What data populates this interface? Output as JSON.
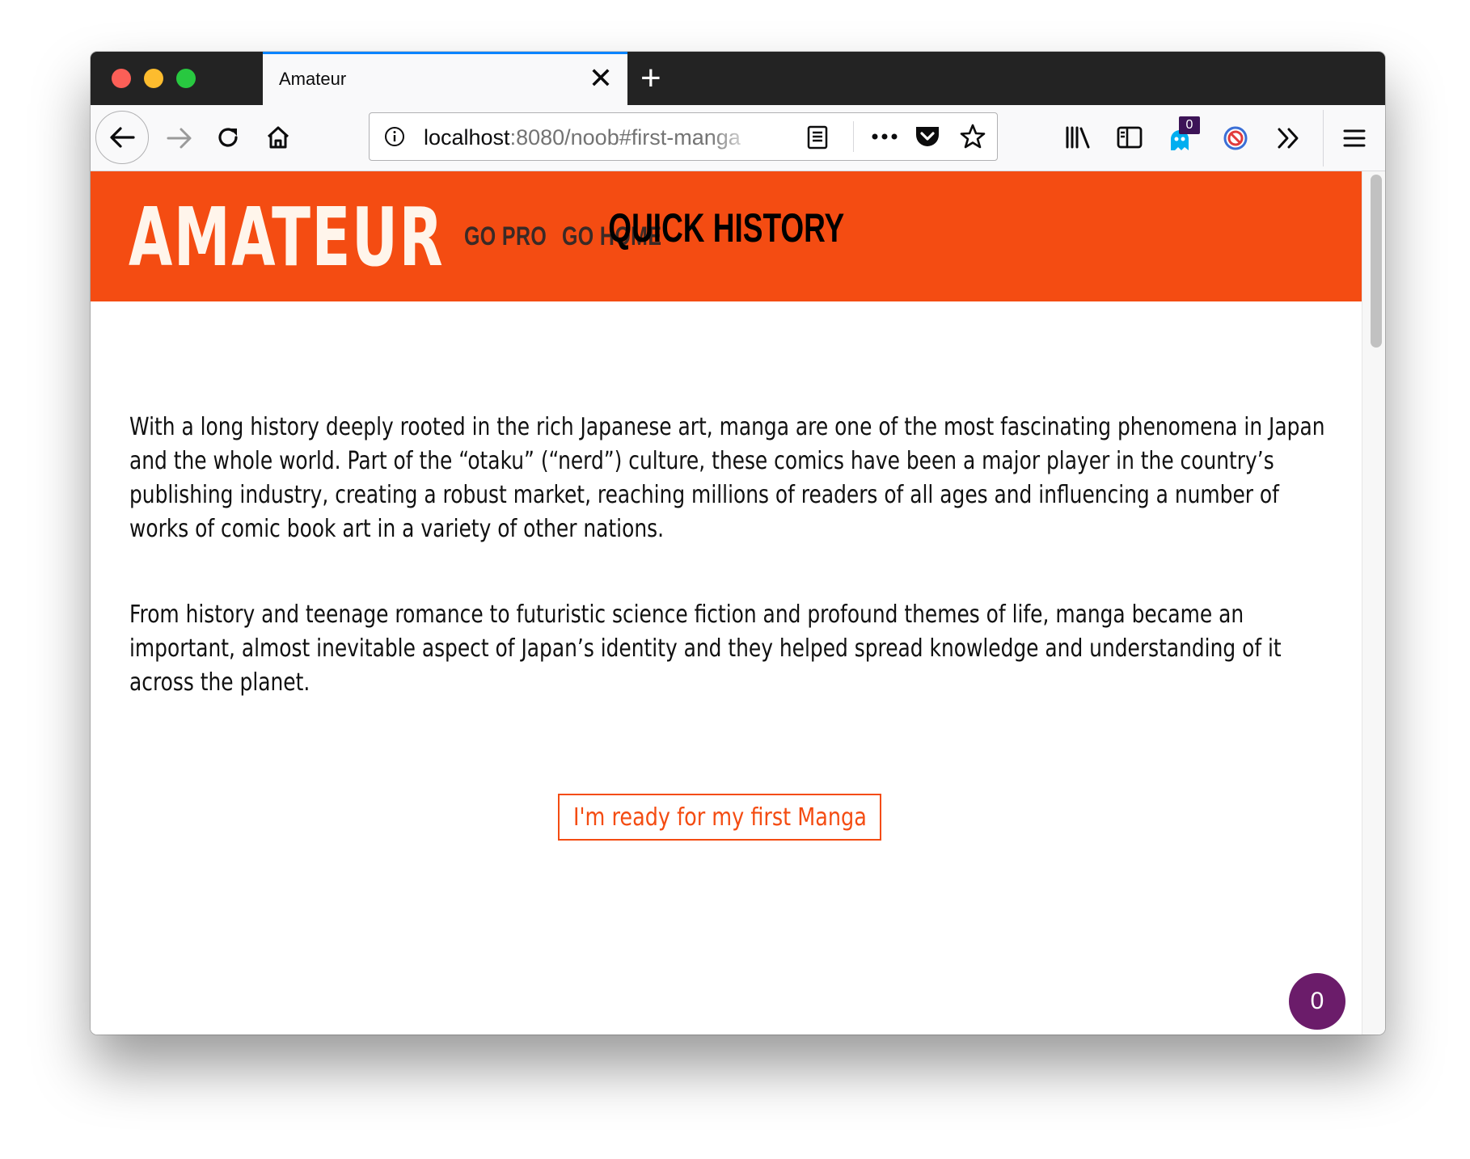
{
  "browser": {
    "tab_title": "Amateur",
    "url_host": "localhost",
    "url_rest": ":8080/noob#first-manga",
    "ghostery_count": "0"
  },
  "site": {
    "logo": "AMATEUR",
    "nav": [
      "GO PRO",
      "GO HOME"
    ],
    "heading": "QUICK HISTORY",
    "paragraphs": [
      "With a long history deeply rooted in the rich Japanese art, manga are one of the most fascinating phenomena in Japan and the whole world. Part of the “otaku” (“nerd”) culture, these comics have been a major player in the country’s publishing industry, creating a robust market, reaching millions of readers of all ages and influencing a number of works of comic book art in a variety of other nations.",
      "From history and teenage romance to futuristic science fiction and profound themes of life, manga became an important, almost inevitable aspect of Japan’s identity and they helped spread knowledge and understanding of it across the planet."
    ],
    "cta_label": "I'm ready for my first Manga",
    "fab_count": "0"
  },
  "colors": {
    "brand": "#f44c12",
    "logo_text": "#fff5eb",
    "fab": "#6b1c6a"
  }
}
